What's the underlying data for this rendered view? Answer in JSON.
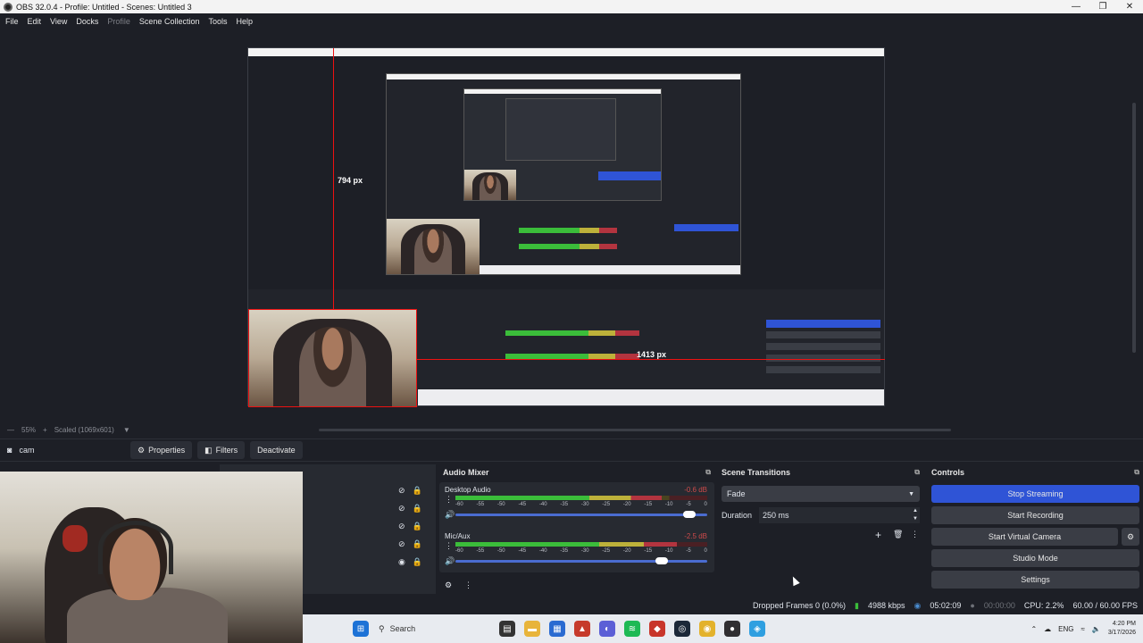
{
  "window": {
    "title": "OBS 32.0.4 - Profile: Untitled - Scenes: Untitled 3",
    "minimize": "—",
    "maximize": "❐",
    "close": "✕"
  },
  "menu": {
    "items": [
      "File",
      "Edit",
      "View",
      "Docks",
      "Profile",
      "Scene Collection",
      "Tools",
      "Help"
    ]
  },
  "preview": {
    "measure_vertical": "794 px",
    "measure_horizontal": "1413 px",
    "zoom": "55%",
    "zoom_plus": "+",
    "scale_mode": "Scaled (1069x601)",
    "scale_arrow": "▼"
  },
  "source_toolbar": {
    "source_name": "cam",
    "properties_label": "Properties",
    "filters_label": "Filters",
    "deactivate_label": "Deactivate"
  },
  "audio_mixer": {
    "title": "Audio Mixer",
    "scale_ticks": [
      "-60",
      "-55",
      "-50",
      "-45",
      "-40",
      "-35",
      "-30",
      "-25",
      "-20",
      "-15",
      "-10",
      "-5",
      "0"
    ],
    "channels": [
      {
        "name": "Desktop Audio",
        "db": "-0.6 dB",
        "level": 0.82,
        "volume": 0.93
      },
      {
        "name": "Mic/Aux",
        "db": "-2.5 dB",
        "level": 0.88,
        "volume": 0.82
      }
    ]
  },
  "scene_transitions": {
    "title": "Scene Transitions",
    "selected": "Fade",
    "duration_label": "Duration",
    "duration_value": "250 ms",
    "add": "+",
    "delete": "🗑",
    "more": "⋮"
  },
  "controls": {
    "title": "Controls",
    "stop_streaming": "Stop Streaming",
    "start_recording": "Start Recording",
    "start_virtual_camera": "Start Virtual Camera",
    "studio_mode": "Studio Mode",
    "settings": "Settings"
  },
  "status": {
    "dropped_frames": "Dropped Frames 0 (0.0%)",
    "bitrate": "4988 kbps",
    "stream_time": "05:02:09",
    "record_time": "00:00:00",
    "cpu": "CPU: 2.2%",
    "fps": "60.00 / 60.00 FPS"
  },
  "taskbar": {
    "search_placeholder": "Search",
    "language": "ENG",
    "time": "4:20 PM",
    "date": "3/17/2026"
  },
  "colors": {
    "accent_blue": "#2f54d6",
    "meter_green": "#3bbd3a",
    "meter_yellow": "#bdb13a",
    "meter_red": "#b3343f",
    "guide_red": "#e11111"
  }
}
